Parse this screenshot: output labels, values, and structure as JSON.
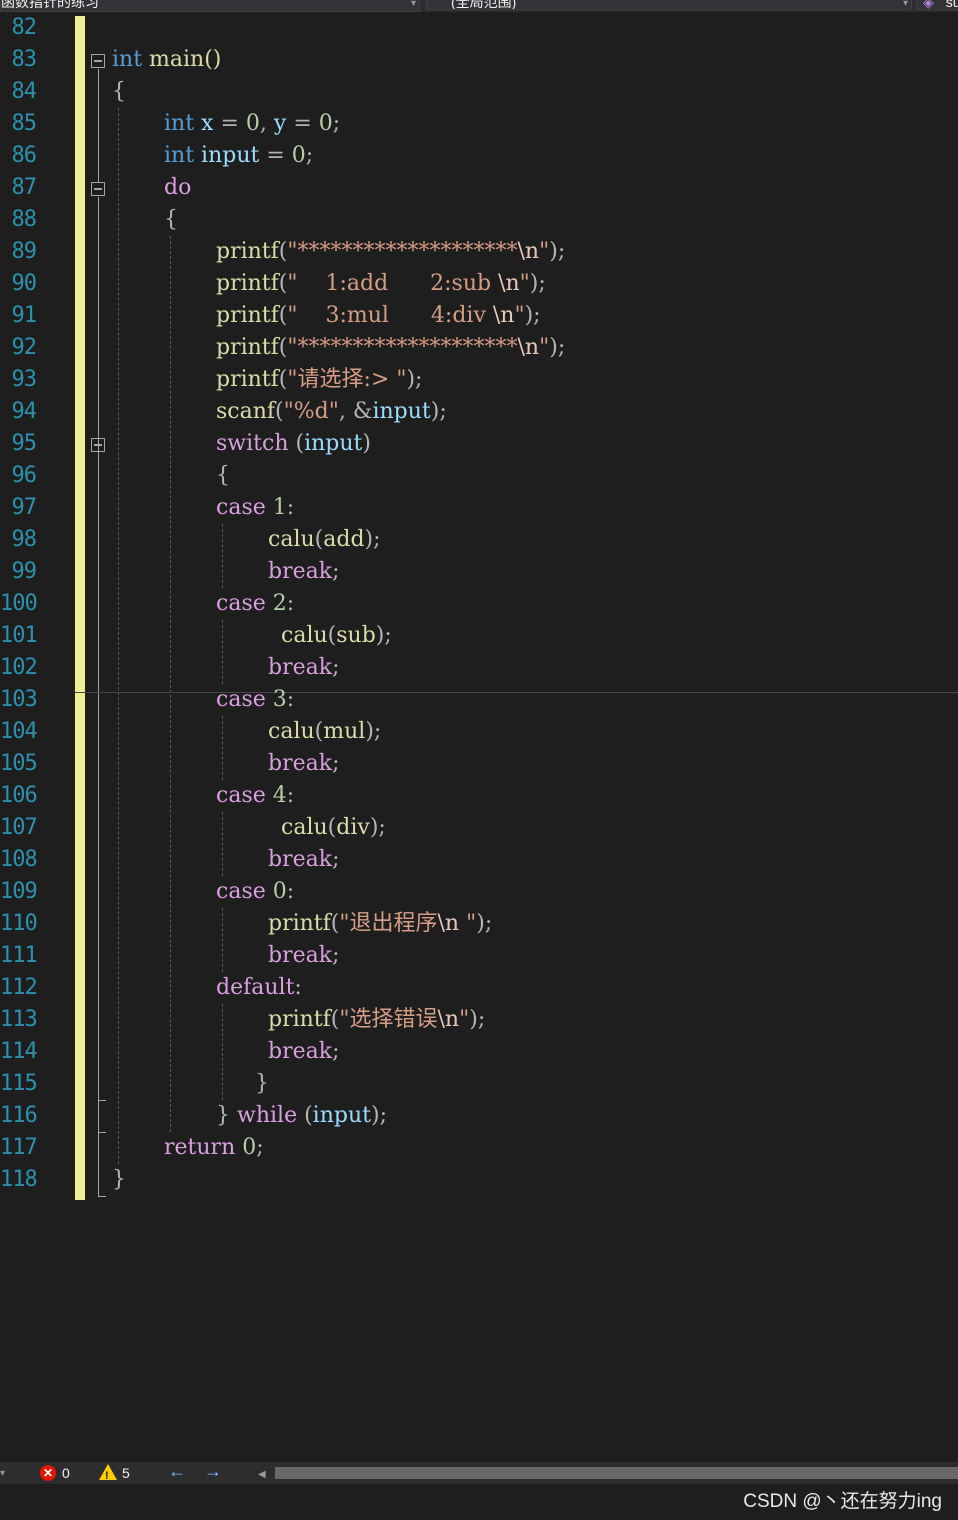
{
  "navbar": {
    "file_dropdown": "函数指针的练习",
    "scope_dropdown": "(全局范围)",
    "member_dropdown_icon": "cube-icon",
    "member_dropdown": "su"
  },
  "editor": {
    "line_numbers": [
      "82",
      "83",
      "84",
      "85",
      "86",
      "87",
      "88",
      "89",
      "90",
      "91",
      "92",
      "93",
      "94",
      "95",
      "96",
      "97",
      "98",
      "99",
      "100",
      "101",
      "102",
      "103",
      "104",
      "105",
      "106",
      "107",
      "108",
      "109",
      "110",
      "111",
      "112",
      "113",
      "114",
      "115",
      "116",
      "117",
      "118"
    ],
    "lines": {
      "l83_kw": "int",
      "l83_rest": " main()",
      "l84": "{",
      "l85_kw": "int",
      "l85_x": "x",
      "l85_eq1": " = ",
      "l85_n1": "0",
      "l85_comma": ", ",
      "l85_y": "y",
      "l85_eq2": " = ",
      "l85_n2": "0",
      "l85_semi": ";",
      "l86_kw": "int",
      "l86_var": "input",
      "l86_eq": " = ",
      "l86_num": "0",
      "l86_semi": ";",
      "l87": "do",
      "l88": "{",
      "l89_fn": "printf",
      "l89_str": "\"********************",
      "l89_esc": "\\n",
      "l89_end": "\"",
      "l90_fn": "printf",
      "l90_str": "\"    1:add      2:sub ",
      "l90_esc": "\\n",
      "l90_end": "\"",
      "l91_fn": "printf",
      "l91_str": "\"    3:mul      4:div ",
      "l91_esc": "\\n",
      "l91_end": "\"",
      "l92_fn": "printf",
      "l92_str": "\"********************",
      "l92_esc": "\\n",
      "l92_end": "\"",
      "l93_fn": "printf",
      "l93_str": "\"请选择:> \"",
      "l94_fn": "scanf",
      "l94_str": "\"%d\"",
      "l94_var": "input",
      "l95_kw": "switch",
      "l95_var": "input",
      "l96": "{",
      "l97_kw": "case",
      "l97_num": "1",
      "l98_fn": "calu",
      "l98_arg": "add",
      "l99": "break",
      "l100_kw": "case",
      "l100_num": "2",
      "l101_fn": "calu",
      "l101_arg": "sub",
      "l102": "break",
      "l103_kw": "case",
      "l103_num": "3",
      "l104_fn": "calu",
      "l104_arg": "mul",
      "l105": "break",
      "l106_kw": "case",
      "l106_num": "4",
      "l107_fn": "calu",
      "l107_arg": "div",
      "l108": "break",
      "l109_kw": "case",
      "l109_num": "0",
      "l110_fn": "printf",
      "l110_str": "\"退出程序",
      "l110_esc": "\\n",
      "l110_end": " \"",
      "l111": "break",
      "l112": "default",
      "l113_fn": "printf",
      "l113_str": "\"选择错误",
      "l113_esc": "\\n",
      "l113_end": "\"",
      "l114": "break",
      "l115": "}",
      "l116_brace": "}",
      "l116_kw": "while",
      "l116_var": "input",
      "l117_kw": "return",
      "l117_num": "0",
      "l118": "}"
    }
  },
  "statusbar": {
    "errors": "0",
    "warnings": "5",
    "back_icon": "arrow-left-icon",
    "forward_icon": "arrow-right-icon"
  },
  "watermark": "CSDN @丶还在努力ing",
  "colors": {
    "background": "#1e1e1e",
    "line_number": "#2b91af",
    "keyword": "#569cd6",
    "control_keyword": "#d8a0df",
    "function": "#dcdcaa",
    "variable": "#9cdcfe",
    "string": "#d69d85",
    "number": "#b5cea8",
    "change_bar": "#efef91"
  }
}
